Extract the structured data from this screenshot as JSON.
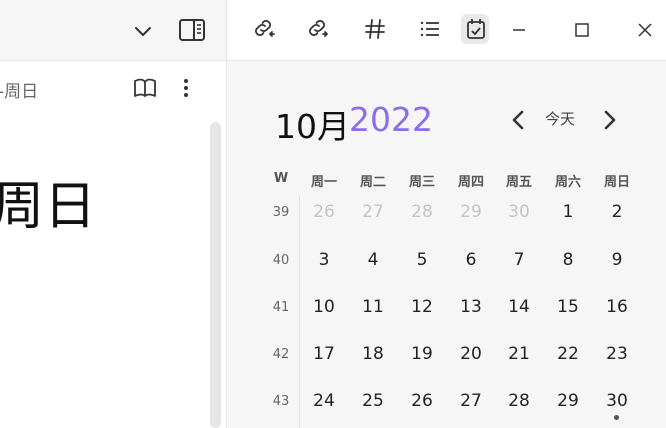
{
  "editor": {
    "breadcrumb": "-周日",
    "title": "周日"
  },
  "calendar": {
    "month": "10月",
    "year": "2022",
    "today_label": "今天",
    "week_col_label": "W",
    "weekdays": [
      "周一",
      "周二",
      "周三",
      "周四",
      "周五",
      "周六",
      "周日"
    ],
    "weeks": [
      {
        "num": "39",
        "days": [
          "26",
          "27",
          "28",
          "29",
          "30",
          "1",
          "2"
        ]
      },
      {
        "num": "40",
        "days": [
          "3",
          "4",
          "5",
          "6",
          "7",
          "8",
          "9"
        ]
      },
      {
        "num": "41",
        "days": [
          "10",
          "11",
          "12",
          "13",
          "14",
          "15",
          "16"
        ]
      },
      {
        "num": "42",
        "days": [
          "17",
          "18",
          "19",
          "20",
          "21",
          "22",
          "23"
        ]
      },
      {
        "num": "43",
        "days": [
          "24",
          "25",
          "26",
          "27",
          "28",
          "29",
          "30"
        ]
      }
    ],
    "muted_days_week0": 5,
    "dot_on": "30",
    "accent_color": "#8b6cef"
  },
  "icons": {
    "toolbar": [
      "backlinks-icon",
      "outgoing-links-icon",
      "tags-icon",
      "outline-icon",
      "calendar-icon"
    ],
    "window": [
      "minimize-icon",
      "maximize-icon",
      "close-icon"
    ]
  }
}
